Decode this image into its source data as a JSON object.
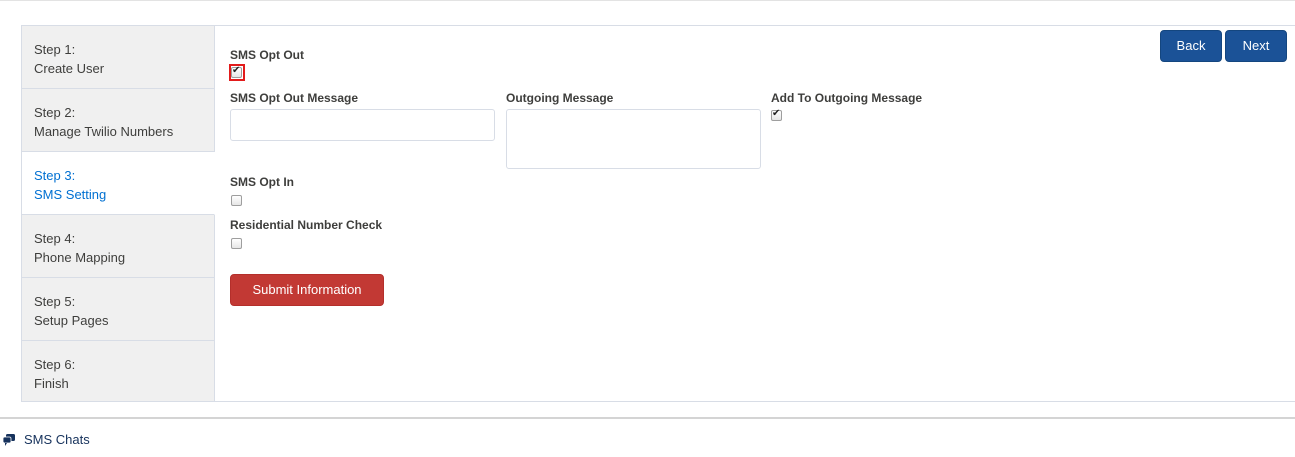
{
  "wizard": {
    "steps": [
      {
        "number": "Step 1:",
        "label": "Create User"
      },
      {
        "number": "Step 2:",
        "label": "Manage Twilio Numbers"
      },
      {
        "number": "Step 3:",
        "label": "SMS Setting"
      },
      {
        "number": "Step 4:",
        "label": "Phone Mapping"
      },
      {
        "number": "Step 5:",
        "label": "Setup Pages"
      },
      {
        "number": "Step 6:",
        "label": "Finish"
      }
    ],
    "active_step": "Step 3:",
    "nav": {
      "back_label": "Back",
      "next_label": "Next"
    }
  },
  "form": {
    "sms_opt_out": {
      "label": "SMS Opt Out",
      "checked": true
    },
    "sms_opt_out_message": {
      "label": "SMS Opt Out Message",
      "value": ""
    },
    "outgoing_message": {
      "label": "Outgoing Message",
      "value": ""
    },
    "add_to_outgoing_message": {
      "label": "Add To Outgoing Message",
      "checked": true
    },
    "sms_opt_in": {
      "label": "SMS Opt In",
      "checked": false
    },
    "residential_number_check": {
      "label": "Residential Number Check",
      "checked": false
    },
    "submit_label": "Submit Information"
  },
  "footer": {
    "label": "SMS Chats",
    "icon": "chat-bubble-icon"
  },
  "colors": {
    "primary_button": "#1b5297",
    "submit_button": "#c23934",
    "active_step_text": "#0070d2",
    "highlight": "#e21b1b"
  }
}
